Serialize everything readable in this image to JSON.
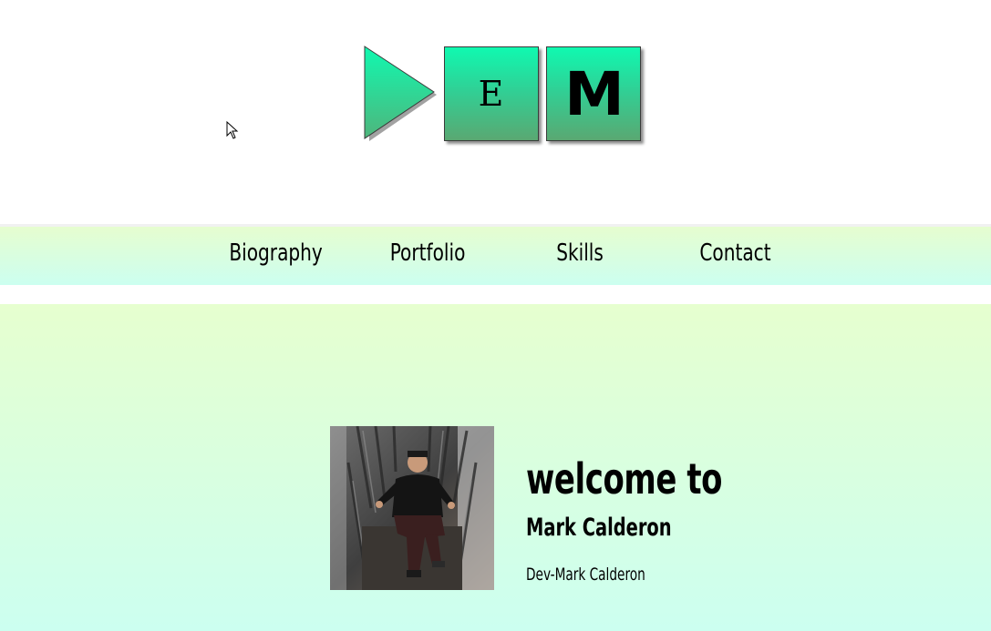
{
  "logo": {
    "letters": [
      "E",
      "M"
    ],
    "tile_gradient": [
      "#10f9b0",
      "#5aa872"
    ],
    "icon": "play-triangle-icon"
  },
  "nav": {
    "items": [
      {
        "label": "Biography"
      },
      {
        "label": "Portfolio"
      },
      {
        "label": "Skills"
      },
      {
        "label": "Contact"
      }
    ],
    "gradient": [
      "#e6fdcf",
      "#ccfff0"
    ]
  },
  "hero": {
    "welcome": "welcome to",
    "name": "Mark Calderon",
    "tagline": "Dev-Mark Calderon",
    "avatar": "profile-photo"
  },
  "cursor": {
    "icon": "mouse-pointer-icon"
  }
}
